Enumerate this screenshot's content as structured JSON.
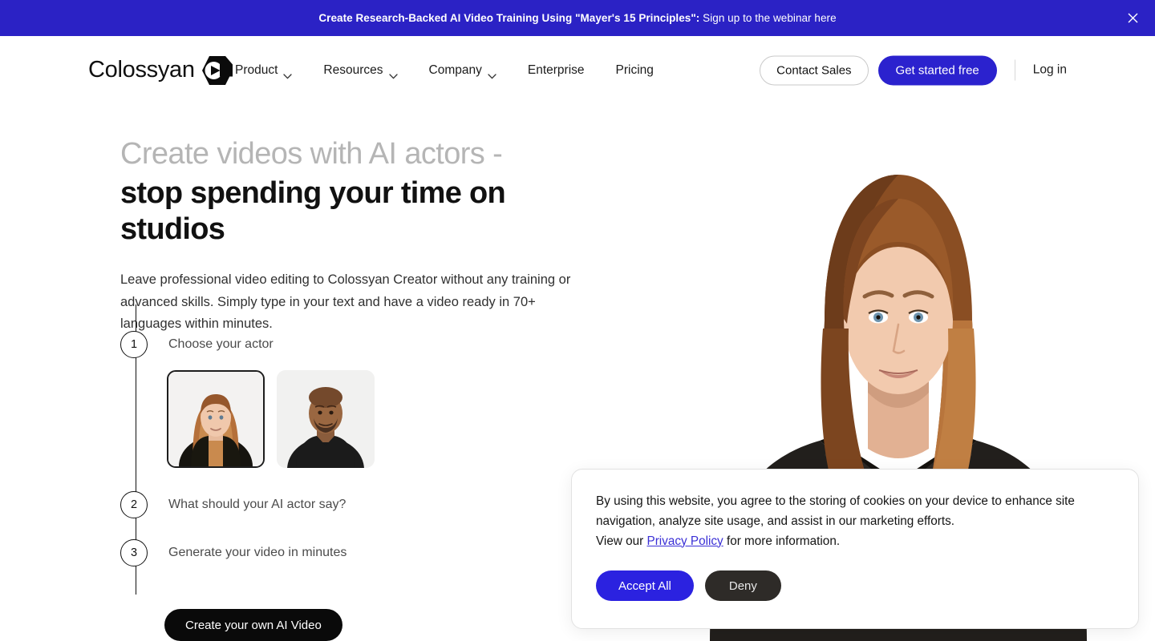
{
  "promo_banner": {
    "strong_text": "Create Research-Backed AI Video Training Using \"Mayer's 15 Principles\":",
    "link_text": " Sign up to the webinar here",
    "close_icon": "close-icon",
    "background_color": "#2B22C5"
  },
  "header": {
    "brand_name": "Colossyan",
    "brand_mark_icon": "hexagon-play-logo-icon",
    "nav": [
      {
        "label": "Product",
        "has_dropdown": true,
        "icon": "chevron-down-icon"
      },
      {
        "label": "Resources",
        "has_dropdown": true,
        "icon": "chevron-down-icon"
      },
      {
        "label": "Company",
        "has_dropdown": true,
        "icon": "chevron-down-icon"
      },
      {
        "label": "Enterprise",
        "has_dropdown": false,
        "icon": ""
      },
      {
        "label": "Pricing",
        "has_dropdown": false,
        "icon": ""
      }
    ],
    "contact_sales_label": "Contact Sales",
    "get_started_label": "Get started free",
    "login_label": "Log in",
    "accent_color": "#2B22CE"
  },
  "hero": {
    "headline_line1": "Create videos with AI actors -",
    "headline_line2": "stop spending your time on studios",
    "subtext": "Leave professional video editing to Colossyan Creator without any training or advanced skills. Simply type in your text and have a video ready in 70+ languages within minutes.",
    "steps": [
      {
        "number": "1",
        "label": "Choose your actor"
      },
      {
        "number": "2",
        "label": "What should your AI actor say?"
      },
      {
        "number": "3",
        "label": "Generate your video in minutes"
      }
    ],
    "actors": [
      {
        "name": "actor-female-auburn",
        "selected": true
      },
      {
        "name": "actor-male-bald",
        "selected": false
      }
    ],
    "cta_label": "Create your own AI Video",
    "portrait_alt": "AI actor portrait - woman with long auburn hair in black jacket"
  },
  "cookie_banner": {
    "text_part1": "By using this website, you agree to the storing of cookies on your device to enhance site navigation, analyze site usage, and assist in our marketing efforts.",
    "text_part2": "View our ",
    "link_label": "Privacy Policy",
    "text_part3": " for more information.",
    "accept_label": "Accept All",
    "deny_label": "Deny",
    "accept_color": "#2B22E0",
    "deny_color": "#2e2b28",
    "link_color": "#3b30d6"
  }
}
